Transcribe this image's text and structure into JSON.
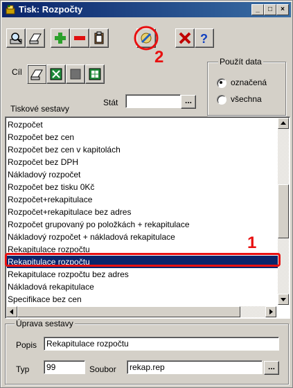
{
  "window": {
    "title": "Tisk: Rozpočty",
    "controls": [
      "minimize",
      "maximize",
      "close"
    ]
  },
  "toolbar": {
    "buttons": [
      "preview-icon",
      "print-icon",
      "add-icon",
      "remove-icon",
      "clipboard-icon",
      "edit-report-icon",
      "delete-icon",
      "help-icon"
    ]
  },
  "target": {
    "label": "Cíl",
    "buttons": [
      "printer-icon",
      "excel-icon",
      "blank-doc-icon",
      "spreadsheet-icon"
    ]
  },
  "filter": {
    "stat_label": "Stát",
    "stat_value": "",
    "browse": "..."
  },
  "use_data": {
    "title": "Použít data",
    "options": [
      {
        "label": "označená",
        "selected": true
      },
      {
        "label": "všechna",
        "selected": false
      }
    ]
  },
  "reports": {
    "title": "Tiskové sestavy",
    "items": [
      "Rozpočet",
      "Rozpočet bez cen",
      "Rozpočet bez cen v kapitolách",
      "Rozpočet bez DPH",
      "Nákladový rozpočet",
      "Rozpočet bez tisku 0Kč",
      "Rozpočet+rekapitulace",
      "Rozpočet+rekapitulace bez adres",
      "Rozpočet grupovaný po položkách + rekapitulace",
      "Nákladový rozpočet + nákladová rekapitulace",
      "Rekapitulace rozpočtu",
      "Rekapitulace rozpočtu",
      "Rekapitulace rozpočtu bez adres",
      "Nákladová rekapitulace",
      "Specifikace bez cen"
    ],
    "selected_index": 11
  },
  "edit": {
    "title": "Úprava sestavy",
    "popis_label": "Popis",
    "popis_value": "Rekapitulace rozpočtu",
    "typ_label": "Typ",
    "typ_value": "99",
    "soubor_label": "Soubor",
    "soubor_value": "rekap.rep",
    "browse": "..."
  },
  "annotations": {
    "one": "1",
    "two": "2",
    "color": "#e81010"
  }
}
